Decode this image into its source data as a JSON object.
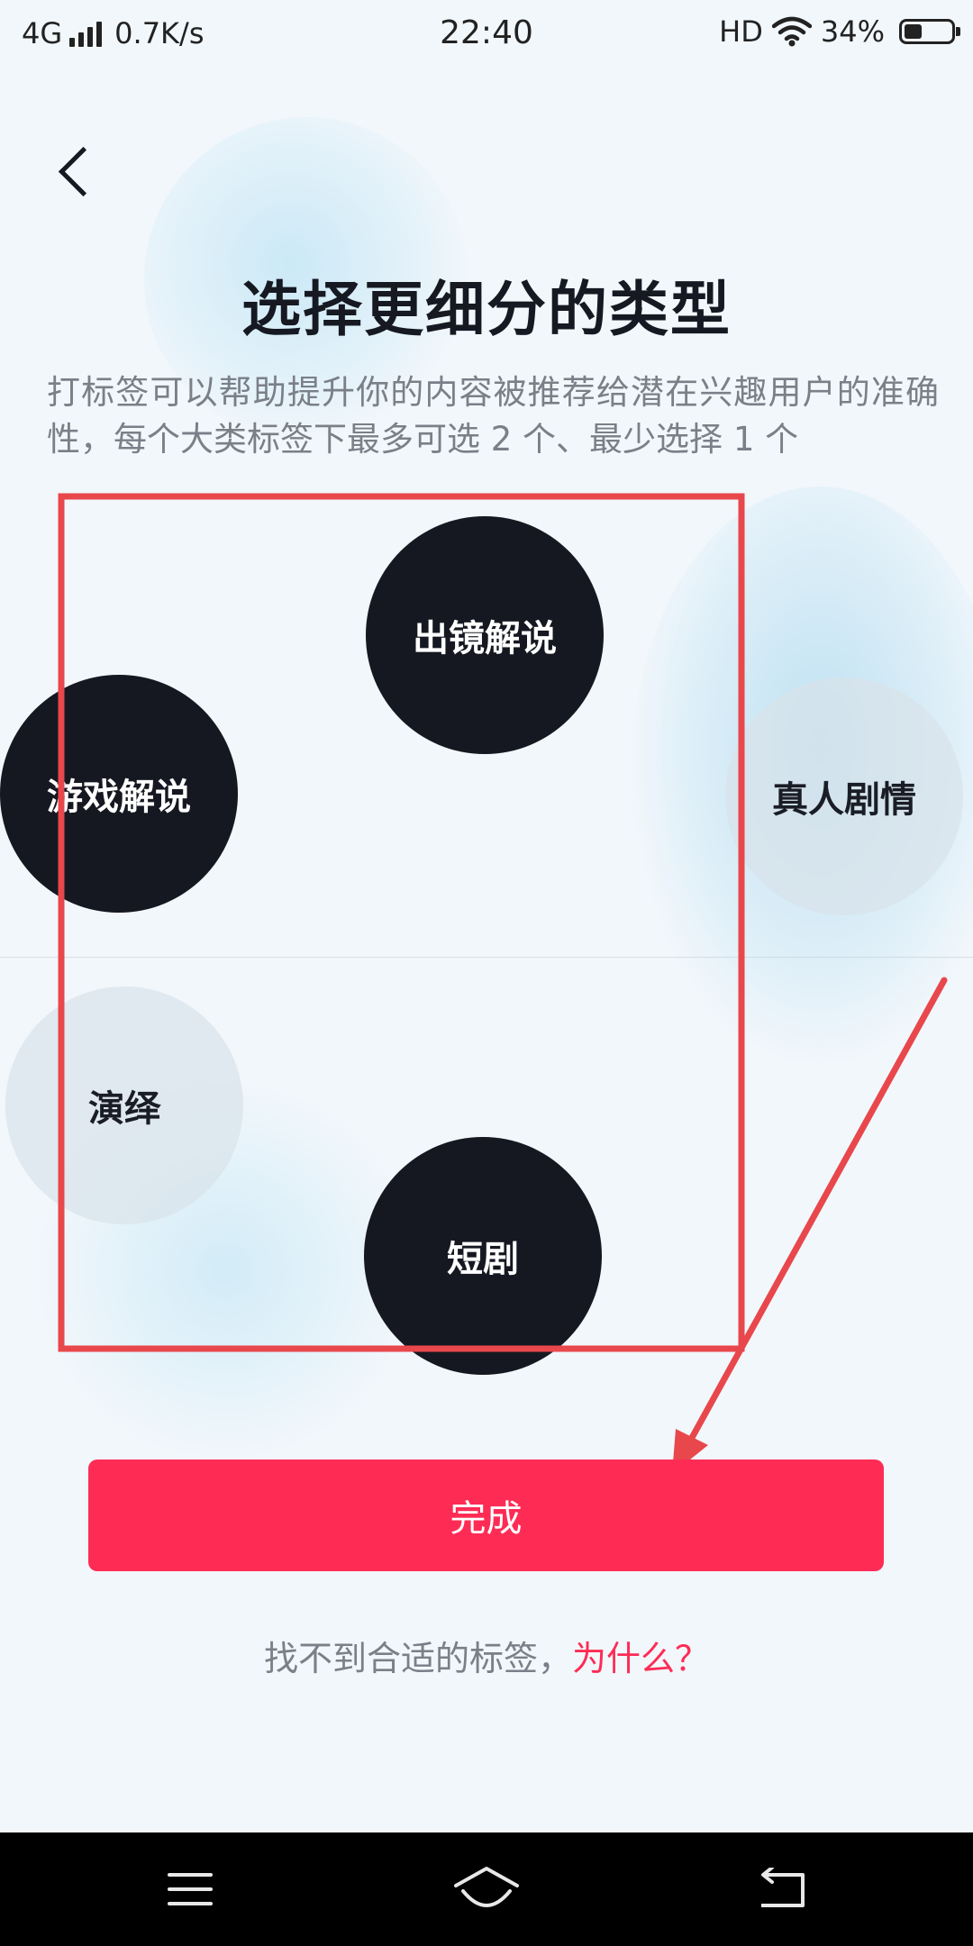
{
  "status_bar": {
    "network": "4G",
    "speed": "0.7K/s",
    "time": "22:40",
    "hd": "HD",
    "battery": "34%",
    "battery_level": 0.34
  },
  "header": {
    "title": "选择更细分的类型",
    "subtitle": "打标签可以帮助提升你的内容被推荐给潜在兴趣用户的准确性，每个大类标签下最多可选 2 个、最少选择 1 个"
  },
  "tags": [
    {
      "label": "出镜解说",
      "selected": true
    },
    {
      "label": "游戏解说",
      "selected": true
    },
    {
      "label": "真人剧情",
      "selected": false
    },
    {
      "label": "演绎",
      "selected": false
    },
    {
      "label": "短剧",
      "selected": true
    }
  ],
  "actions": {
    "done_label": "完成",
    "help_text": "找不到合适的标签，",
    "help_link": "为什么？"
  },
  "colors": {
    "accent": "#fe2c55",
    "selected_bubble": "#161821",
    "unselected_bubble": "#d8e2ea",
    "annotation": "#e8474c"
  },
  "icons": {
    "back": "back-chevron-icon",
    "nav_menu": "menu-icon",
    "nav_home": "home-icon",
    "nav_back": "return-icon"
  }
}
